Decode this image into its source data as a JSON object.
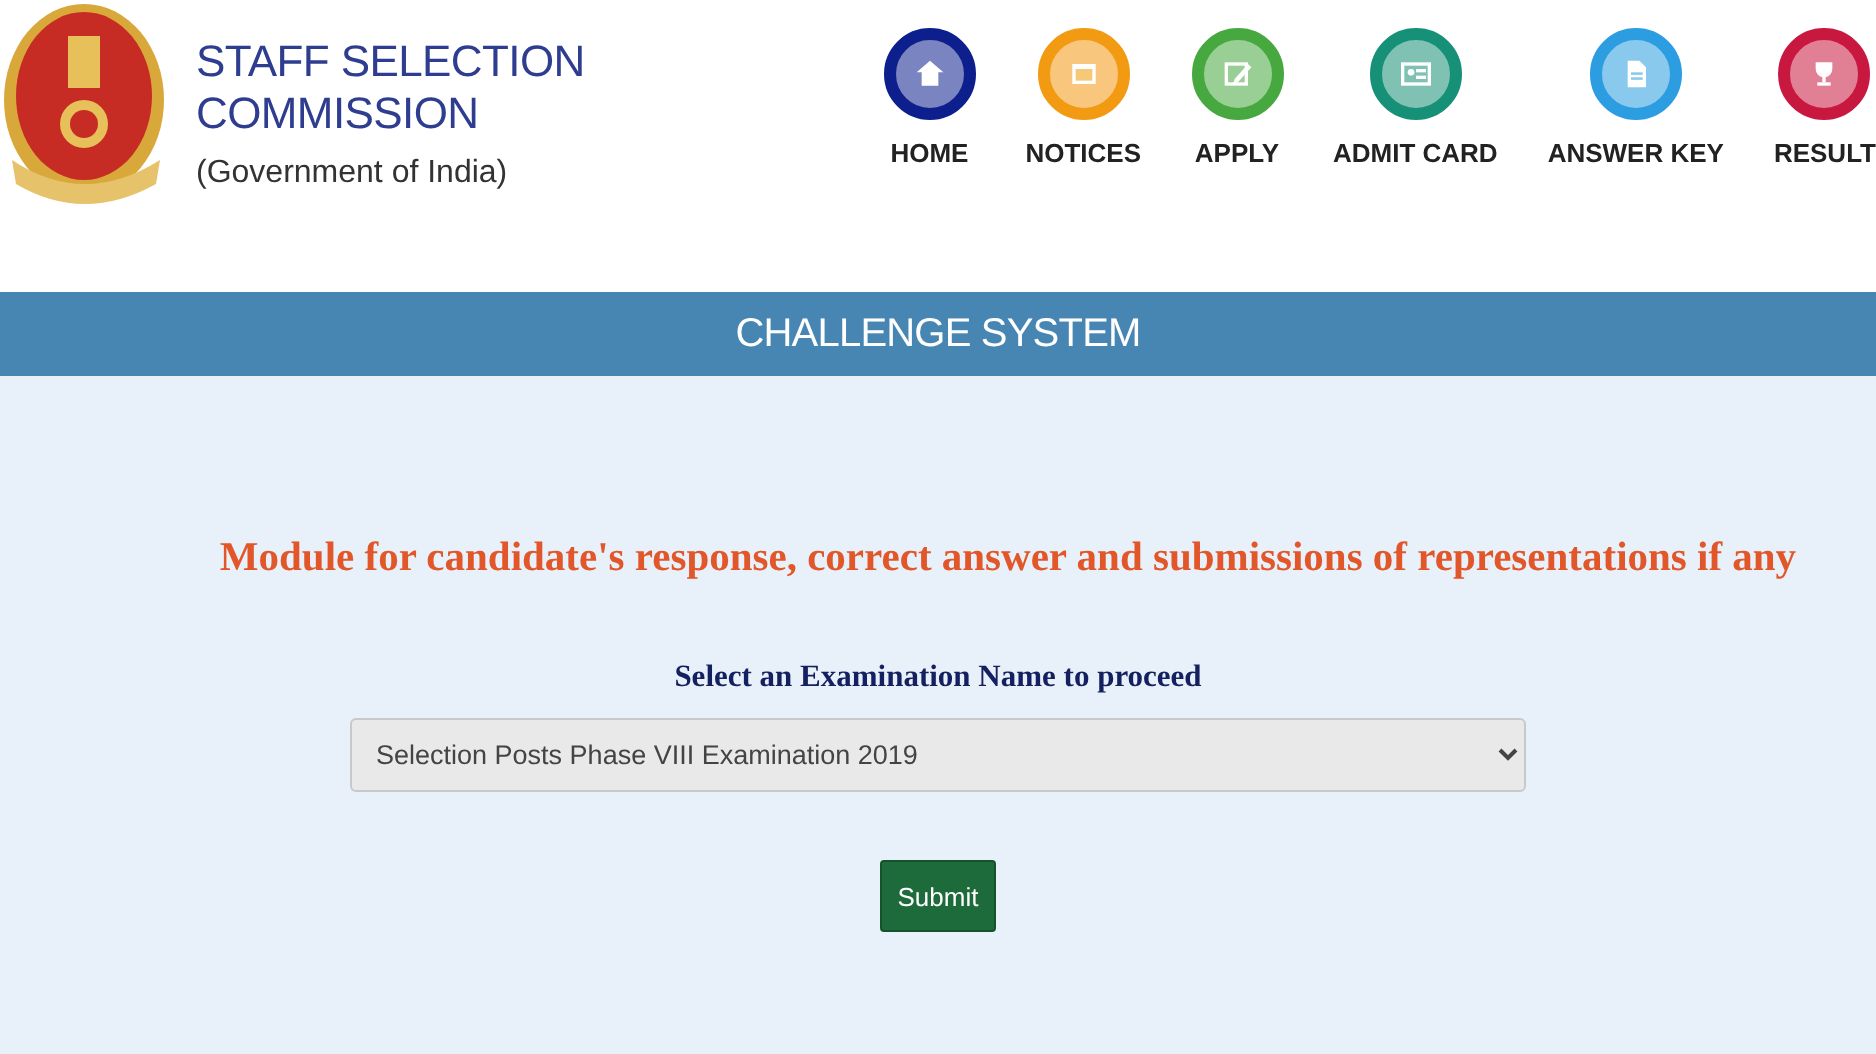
{
  "header": {
    "title": "STAFF SELECTION COMMISSION",
    "subtitle": "(Government of India)"
  },
  "nav": [
    {
      "label": "HOME",
      "kind": "house",
      "color": "#0d1f8c"
    },
    {
      "label": "NOTICES",
      "kind": "board",
      "color": "#f29a12"
    },
    {
      "label": "APPLY",
      "kind": "pencil",
      "color": "#46a83f"
    },
    {
      "label": "ADMIT CARD",
      "kind": "card",
      "color": "#169077"
    },
    {
      "label": "ANSWER KEY",
      "kind": "document",
      "color": "#2b9de0"
    },
    {
      "label": "RESULT",
      "kind": "trophy",
      "color": "#c9183f"
    }
  ],
  "banner": {
    "title": "CHALLENGE SYSTEM"
  },
  "form": {
    "heading": "Module for candidate's response, correct answer and submissions of representations if any",
    "label": "Select an Examination Name to proceed",
    "exam": {
      "value": "Selection Posts Phase VIII Examination 2019"
    },
    "submit": "Submit"
  }
}
